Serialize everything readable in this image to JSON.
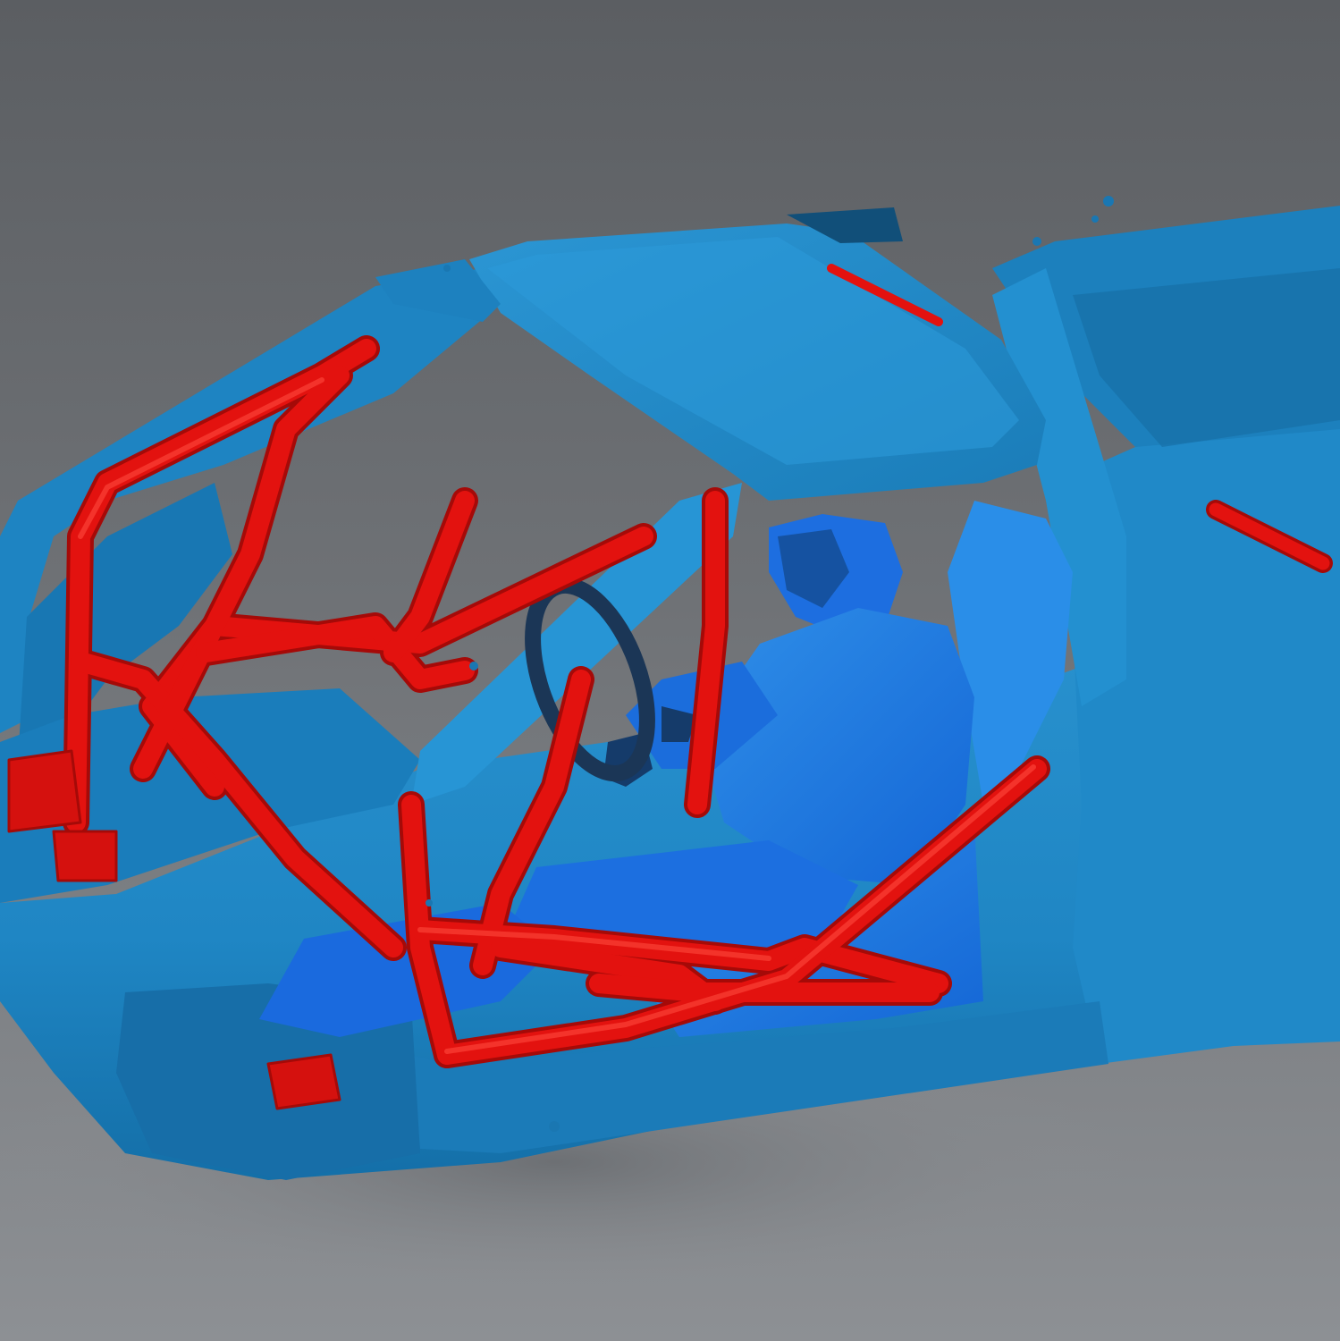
{
  "scene": {
    "subject": "3d-scan-render",
    "colors": {
      "background_top": "#5b5e62",
      "background_bottom": "#8d9094",
      "scan_body": "#1f86c4",
      "scan_highlight": "#3aa6e2",
      "scan_shadow": "#0f5f93",
      "occupant": "#1a6fe0",
      "roll_cage": "#e3120f",
      "roll_cage_shadow": "#a50a08",
      "ground_shadow": "#7a7d81"
    }
  }
}
